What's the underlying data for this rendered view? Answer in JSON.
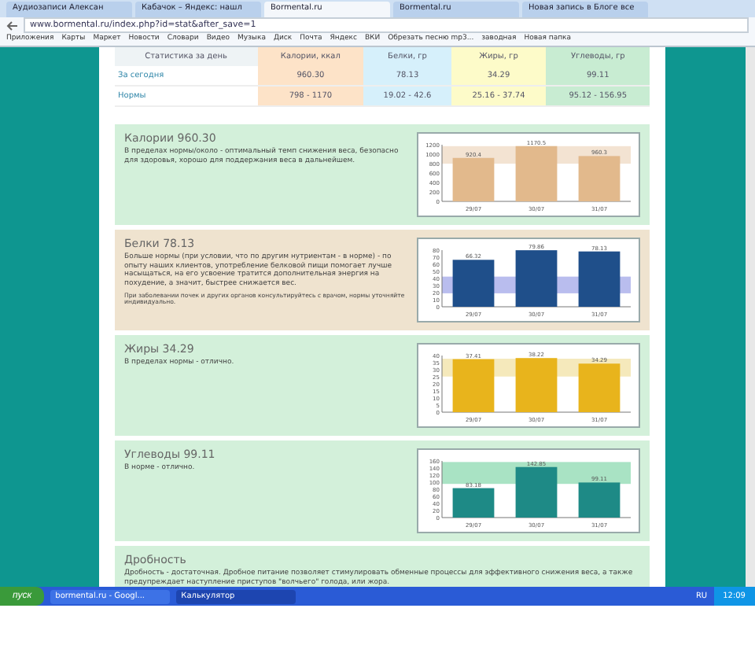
{
  "browser": {
    "tabs": [
      {
        "title": "Аудиозаписи Алексан",
        "selected": false
      },
      {
        "title": "Кабачок – Яндекс: нашл",
        "selected": false
      },
      {
        "title": "Bormental.ru",
        "selected": true
      },
      {
        "title": "Bormental.ru",
        "selected": false
      },
      {
        "title": "Новая запись в Блоге все",
        "selected": false
      }
    ],
    "address": "www.bormental.ru/index.php?id=stat&after_save=1",
    "bookmarks": [
      "Приложения",
      "Карты",
      "Маркет",
      "Новости",
      "Словари",
      "Видео",
      "Музыка",
      "Диск",
      "Почта",
      "Яндекс",
      "ВКИ",
      "Обрезать песню mp3...",
      "заводная",
      "Новая папка"
    ]
  },
  "stats_table": {
    "columns": [
      "Статистика за день",
      "Калории, ккал",
      "Белки, гр",
      "Жиры, гр",
      "Углеводы, гр"
    ],
    "rows": [
      [
        "За сегодня",
        "960.30",
        "78.13",
        "34.29",
        "99.11"
      ],
      [
        "Нормы",
        "798 - 1170",
        "19.02 - 42.6",
        "25.16 - 37.74",
        "95.12 - 156.95"
      ]
    ]
  },
  "panels": [
    {
      "title": "Калории 960.30",
      "color": "#d3f0da",
      "text": "В пределах нормы/около - оптимальный темп снижения веса, безопасно для здоровья, хорошо для поддержания веса в дальнейшем.",
      "chart_data": {
        "type": "bar",
        "categories": [
          "29/07",
          "30/07",
          "31/07"
        ],
        "series": [
          {
            "color": "#e2b98c",
            "values": [
              920.4,
              1170.5,
              960.3
            ]
          }
        ],
        "ylim": [
          0,
          1200
        ],
        "yticks": [
          0,
          200,
          400,
          600,
          800,
          1000,
          1200
        ],
        "data_labels": true,
        "bands": [
          {
            "axis": "y",
            "from": 798,
            "to": 1170,
            "color": "#f3e3d2"
          }
        ]
      }
    },
    {
      "title": "Белки 78.13",
      "color": "#efe3cf",
      "text": "Больше нормы (при условии, что по другим нутриентам - в норме) - по опыту наших клиентов, употребление белковой пищи помогает лучше насыщаться, на его усвоение тратится дополнительная энергия на похудение, а значит, быстрее снижается вес.",
      "note": "При заболевании почек и других органов консультируйтесь с врачом, нормы уточняйте индивидуально.",
      "chart_data": {
        "type": "bar",
        "categories": [
          "29/07",
          "30/07",
          "31/07"
        ],
        "series": [
          {
            "color": "#1f4f8a",
            "values": [
              66.32,
              79.86,
              78.13
            ]
          }
        ],
        "ylim": [
          0,
          80
        ],
        "yticks": [
          0,
          10,
          20,
          30,
          40,
          50,
          60,
          70,
          80
        ],
        "data_labels": true,
        "bands": [
          {
            "axis": "y",
            "from": 19.02,
            "to": 42.6,
            "color": "#b9bdee"
          }
        ]
      }
    },
    {
      "title": "Жиры 34.29",
      "color": "#d3f0da",
      "text": "В пределах нормы - отлично.",
      "chart_data": {
        "type": "bar",
        "categories": [
          "29/07",
          "30/07",
          "31/07"
        ],
        "series": [
          {
            "color": "#e8b41c",
            "values": [
              37.41,
              38.22,
              34.29
            ]
          }
        ],
        "ylim": [
          0,
          40
        ],
        "yticks": [
          0,
          5,
          10,
          15,
          20,
          25,
          30,
          35,
          40
        ],
        "data_labels": true,
        "bands": [
          {
            "axis": "y",
            "from": 25.16,
            "to": 37.74,
            "color": "#f5e9bb"
          }
        ]
      }
    },
    {
      "title": "Углеводы 99.11",
      "color": "#d3f0da",
      "text": "В норме - отлично.",
      "chart_data": {
        "type": "bar",
        "categories": [
          "29/07",
          "30/07",
          "31/07"
        ],
        "series": [
          {
            "color": "#1e8a86",
            "values": [
              83.18,
              142.85,
              99.11
            ]
          }
        ],
        "ylim": [
          0,
          160
        ],
        "yticks": [
          0,
          20,
          40,
          60,
          80,
          100,
          120,
          140,
          160
        ],
        "data_labels": true,
        "bands": [
          {
            "axis": "y",
            "from": 95.12,
            "to": 156.95,
            "color": "#a9e3c4"
          }
        ]
      }
    },
    {
      "title": "Дробность",
      "color": "#d3f0da",
      "text": "Дробность - достаточная. Дробное питание позволяет стимулировать обменные процессы для эффективного снижения веса, а также предупреждает наступление приступов \"волчьего\" голода, или жора."
    }
  ],
  "taskbar": {
    "start": "пуск",
    "windows": [
      {
        "title": "bormental.ru - Googl...",
        "selected": false
      },
      {
        "title": "Калькулятор",
        "selected": true
      }
    ],
    "language": "RU",
    "clock": "12:09"
  }
}
